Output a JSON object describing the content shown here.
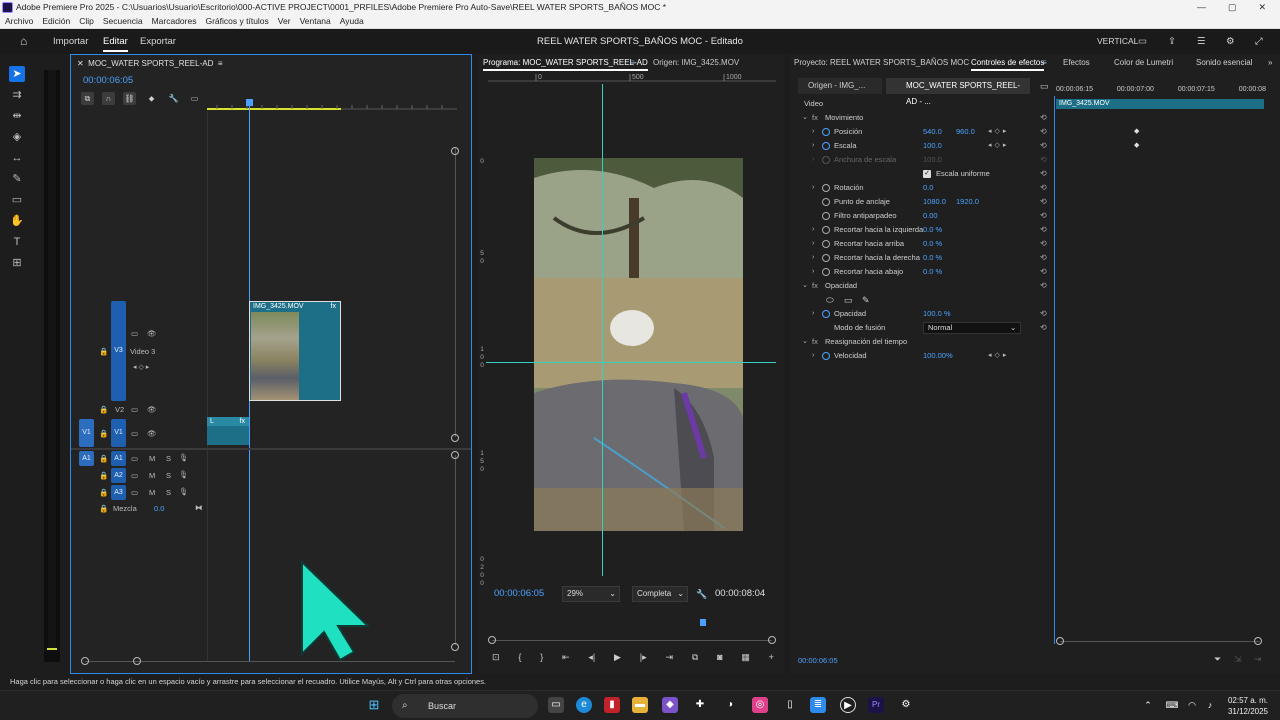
{
  "window": {
    "title": "Adobe Premiere Pro 2025 - C:\\Usuarios\\Usuario\\Escritorio\\000-ACTIVE PROJECT\\0001_PRFILES\\Adobe Premiere Pro Auto-Save\\REEL WATER SPORTS_BAÑOS MOC *",
    "controls": [
      "—",
      "▢",
      "✕"
    ]
  },
  "menu": [
    "Archivo",
    "Edición",
    "Clip",
    "Secuencia",
    "Marcadores",
    "Gráficos y títulos",
    "Ver",
    "Ventana",
    "Ayuda"
  ],
  "header": {
    "tabs": [
      "Importar",
      "Editar",
      "Exportar"
    ],
    "active_tab": "Editar",
    "document": "REEL WATER SPORTS_BAÑOS MOC - Editado",
    "workspace": "VERTICAL"
  },
  "timeline": {
    "sequence_name": "MOC_WATER SPORTS_REEL-AD",
    "timecode": "00:00:06:05",
    "tracks": {
      "v3": "V3",
      "v3_name": "Video 3",
      "v2": "V2",
      "v1_src": "V1",
      "v1": "V1",
      "a1_src": "A1",
      "a1": "A1",
      "a2": "A2",
      "a3": "A3",
      "mix_label": "Mezcla",
      "mix_value": "0.0",
      "m": "M",
      "s": "S"
    },
    "clips": {
      "v3_clip": "IMG_3425.MOV",
      "fx": "fx",
      "v1_marker": "L"
    }
  },
  "program": {
    "title": "Programa: MOC_WATER SPORTS_REEL-AD",
    "source": "Origen: IMG_3425.MOV",
    "ruler_labels": [
      "0",
      "500",
      "1000"
    ],
    "vruler_labels": [
      "0",
      "5",
      "0",
      "1",
      "0",
      "0",
      "1",
      "5",
      "0",
      "0",
      "2",
      "0",
      "0"
    ],
    "timecode": "00:00:06:05",
    "zoom": "29%",
    "quality": "Completa",
    "duration": "00:00:08:04"
  },
  "effects": {
    "panel_tabs": [
      "Proyecto: REEL WATER SPORTS_BAÑOS MOC",
      "Controles de efectos",
      "Efectos",
      "Color de Lumetri",
      "Sonido esencial"
    ],
    "active_tab": "Controles de efectos",
    "subtabs": [
      "Origen - IMG_...",
      "MOC_WATER SPORTS_REEL-AD - ..."
    ],
    "timecodes": [
      "00:00:06:15",
      "00:00:07:00",
      "00:00:07:15",
      "00:00:08"
    ],
    "clip_label": "IMG_3425.MOV",
    "section_video": "Video",
    "movimiento": "Movimiento",
    "posicion": "Posición",
    "pos_x": "540.0",
    "pos_y": "960.0",
    "escala": "Escala",
    "escala_val": "100.0",
    "anchura": "Anchura de escala",
    "anchura_val": "100.0",
    "uniforme": "Escala uniforme",
    "rotacion": "Rotación",
    "rot_val": "0.0",
    "ancla": "Punto de anclaje",
    "ancla_x": "1080.0",
    "ancla_y": "1920.0",
    "antiparp": "Filtro antiparpadeo",
    "antiparp_val": "0.00",
    "rec_izq": "Recortar hacia la izquierda",
    "rec_izq_val": "0.0 %",
    "rec_arr": "Recortar hacia arriba",
    "rec_arr_val": "0.0 %",
    "rec_der": "Recortar hacia la derecha",
    "rec_der_val": "0.0 %",
    "rec_aba": "Recortar hacia abajo",
    "rec_aba_val": "0.0 %",
    "opacidad_sec": "Opacidad",
    "opacidad": "Opacidad",
    "opacidad_val": "100.0 %",
    "fusion": "Modo de fusión",
    "fusion_val": "Normal",
    "reasign": "Reasignación del tiempo",
    "velocidad": "Velocidad",
    "velocidad_val": "100.00%",
    "fx": "fx",
    "footer_time": "00:00:06:05"
  },
  "status": "Haga clic para seleccionar o haga clic en un espacio vacío y arrastre para seleccionar el recuadro. Utilice Mayús, Alt y Ctrl para otras opciones.",
  "taskbar": {
    "search": "Buscar",
    "time": "02:57 a. m.",
    "date": "31/12/2025"
  },
  "colors": {
    "accent": "#1473e6",
    "timecode": "#4da3ff",
    "clip": "#1c6f86",
    "guide": "#35d1c0",
    "cursor": "#1fe0c0"
  }
}
